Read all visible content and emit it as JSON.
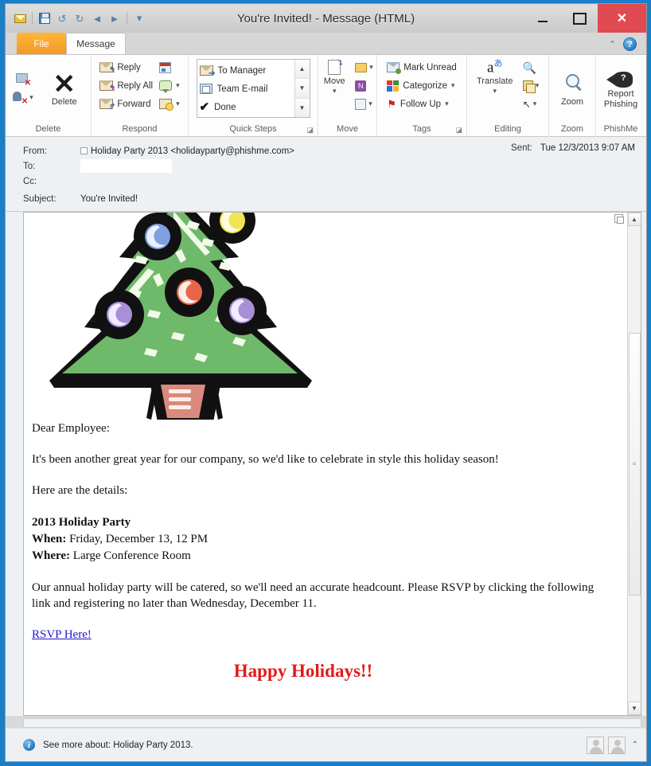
{
  "window": {
    "title": "You're Invited!  -  Message (HTML)",
    "minimize_label": "Minimize",
    "maximize_label": "Maximize",
    "close_label": "✕"
  },
  "quick_access": {
    "items": [
      {
        "name": "outlook-icon",
        "label": ""
      },
      {
        "name": "save-icon",
        "label": ""
      },
      {
        "name": "undo-icon",
        "label": "↺"
      },
      {
        "name": "redo-icon",
        "label": "↻"
      },
      {
        "name": "previous-item-icon",
        "label": "◄"
      },
      {
        "name": "next-item-icon",
        "label": "►"
      },
      {
        "name": "customize-qat-icon",
        "label": "▾"
      }
    ]
  },
  "tabs": {
    "file": "File",
    "message": "Message",
    "minimize_ribbon": "⌃",
    "help": "?"
  },
  "ribbon": {
    "groups": [
      {
        "name": "delete",
        "label": "Delete",
        "buttons": [
          {
            "label": "Ignore"
          },
          {
            "label": "Junk"
          },
          {
            "label": "Delete"
          }
        ]
      },
      {
        "name": "respond",
        "label": "Respond",
        "buttons": [
          {
            "label": "Reply"
          },
          {
            "label": "Reply All"
          },
          {
            "label": "Forward"
          },
          {
            "label": "Meeting"
          },
          {
            "label": "IM"
          },
          {
            "label": "More"
          }
        ]
      },
      {
        "name": "quick-steps",
        "label": "Quick Steps",
        "buttons": [
          {
            "label": "To Manager"
          },
          {
            "label": "Team E-mail"
          },
          {
            "label": "Done"
          }
        ],
        "dialog_launcher": "⌐"
      },
      {
        "name": "move",
        "label": "Move",
        "buttons": [
          {
            "label": "Move"
          },
          {
            "label": "Rules"
          },
          {
            "label": "OneNote"
          },
          {
            "label": "Actions"
          }
        ]
      },
      {
        "name": "tags",
        "label": "Tags",
        "buttons": [
          {
            "label": "Mark Unread"
          },
          {
            "label": "Categorize"
          },
          {
            "label": "Follow Up"
          }
        ],
        "dialog_launcher": "⌐"
      },
      {
        "name": "editing",
        "label": "Editing",
        "buttons": [
          {
            "label": "Translate"
          },
          {
            "label": "Find"
          },
          {
            "label": "Select"
          }
        ]
      },
      {
        "name": "zoom",
        "label": "Zoom",
        "buttons": [
          {
            "label": "Zoom"
          }
        ]
      },
      {
        "name": "phishme",
        "label": "PhishMe",
        "buttons": [
          {
            "label": "Report Phishing"
          }
        ]
      }
    ],
    "respond": {
      "reply": "Reply",
      "reply_all": "Reply All",
      "forward": "Forward"
    },
    "quick_steps": {
      "to_manager": "To Manager",
      "team_email": "Team E-mail",
      "done": "Done"
    },
    "move": {
      "label": "Move"
    },
    "tags": {
      "mark_unread": "Mark Unread",
      "categorize": "Categorize",
      "follow_up": "Follow Up"
    },
    "editing": {
      "translate": "Translate"
    },
    "zoom": {
      "label": "Zoom"
    },
    "phishme": {
      "line1": "Report",
      "line2": "Phishing"
    }
  },
  "header": {
    "from_label": "From:",
    "from_value": "Holiday Party 2013 <holidayparty@phishme.com>",
    "to_label": "To:",
    "to_value": "",
    "cc_label": "Cc:",
    "cc_value": "",
    "subject_label": "Subject:",
    "subject_value": "You're Invited!",
    "sent_label": "Sent:",
    "sent_value": "Tue 12/3/2013 9:07 AM"
  },
  "body": {
    "salutation": "Dear Employee:",
    "paragraph1": "It's been another great year for our company, so we'd like to celebrate in style this holiday season!",
    "paragraph2": "Here are the details:",
    "event_title": "2013 Holiday Party",
    "when_label": "When:",
    "when_value": "Friday, December 13, 12 PM",
    "where_label": "Where:",
    "where_value": "Large Conference Room",
    "paragraph3": "Our annual holiday party will be catered, so we'll need an accurate headcount. Please RSVP by clicking the following link and registering no later than Wednesday, December 11.",
    "rsvp_link": "RSVP Here!",
    "closing": "Happy Holidays!!",
    "image_alt": "christmas-tree-clipart"
  },
  "footer": {
    "info_icon": "i",
    "text": "See more about: Holiday Party 2013.",
    "expand_caret": "⌃"
  },
  "colors": {
    "accent": "#1b7ec7",
    "file_tab": "#f5972b",
    "close_button": "#e04a51",
    "link": "#2414d0",
    "closing_text": "#e01b1b",
    "tree_green": "#6fb96a",
    "ornament_yellow": "#f2e455",
    "ornament_blue": "#7f9fe0",
    "ornament_red": "#e9654a",
    "ornament_purple": "#a98fd8",
    "trunk": "#d9897e"
  }
}
